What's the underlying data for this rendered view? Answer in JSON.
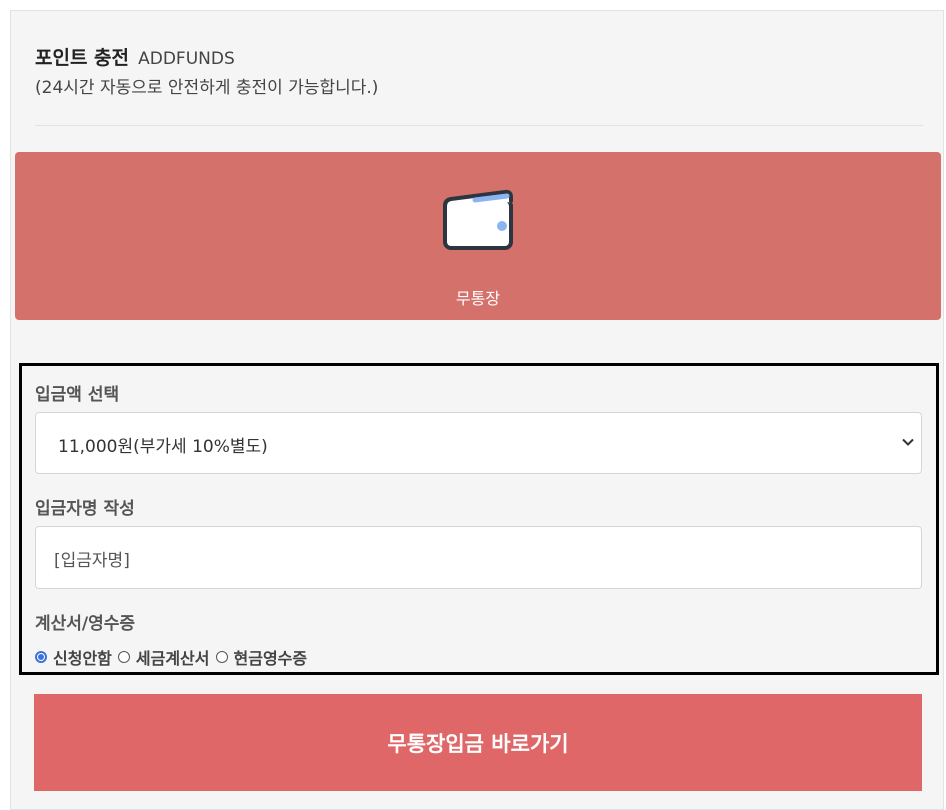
{
  "header": {
    "title": "포인트 충전",
    "subtitle": "ADDFUNDS",
    "description": "(24시간 자동으로 안전하게 충전이 가능합니다.)"
  },
  "payment_method": {
    "label": "무통장",
    "icon": "wallet-icon",
    "color": "#d4716a"
  },
  "form": {
    "amount_label": "입금액 선택",
    "amount_selected": "11,000원(부가세 10%별도)",
    "depositor_label": "입금자명 작성",
    "depositor_value": "[입금자명]",
    "receipt_label": "계산서/영수증",
    "receipt_options": [
      "신청안함",
      "세금계산서",
      "현금영수증"
    ],
    "receipt_selected": "신청안함"
  },
  "submit": {
    "label": "무통장입금 바로가기",
    "color": "#e06768"
  }
}
